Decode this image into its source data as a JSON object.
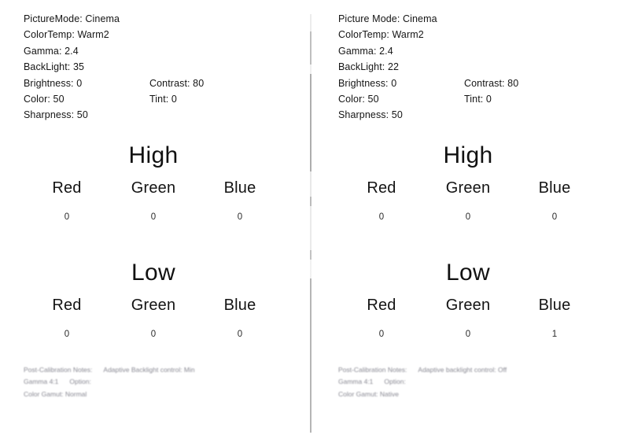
{
  "document": {
    "title": "TV Calibration Settings Comparison",
    "divider_color": "#a8a8a8"
  },
  "panels": [
    {
      "id": "left",
      "settings": {
        "picture_mode_label": "PictureMode: Cinema",
        "color_temp_label": "ColorTemp: Warm2",
        "gamma_label": "Gamma: 2.4",
        "backlight_label": "BackLight: 35",
        "brightness_label": "Brightness: 0",
        "contrast_label": "Contrast: 80",
        "color_label": "Color: 50",
        "tint_label": "Tint: 0",
        "sharpness_label": "Sharpness: 50"
      },
      "high": {
        "title": "High",
        "channels": [
          {
            "label": "Red",
            "value": "0"
          },
          {
            "label": "Green",
            "value": "0"
          },
          {
            "label": "Blue",
            "value": "0"
          }
        ]
      },
      "low": {
        "title": "Low",
        "channels": [
          {
            "label": "Red",
            "value": "0"
          },
          {
            "label": "Green",
            "value": "0"
          },
          {
            "label": "Blue",
            "value": "0"
          }
        ]
      },
      "notes": {
        "line1_a": "Post-Calibration Notes:",
        "line1_b": "Adaptive Backlight control: Min",
        "line2_a": "Gamma 4:1",
        "line2_b": "Option:",
        "line3": "Color Gamut: Normal"
      }
    },
    {
      "id": "right",
      "settings": {
        "picture_mode_label": "Picture Mode: Cinema",
        "color_temp_label": "ColorTemp: Warm2",
        "gamma_label": "Gamma: 2.4",
        "backlight_label": "BackLight: 22",
        "brightness_label": "Brightness: 0",
        "contrast_label": "Contrast: 80",
        "color_label": "Color: 50",
        "tint_label": "Tint: 0",
        "sharpness_label": "Sharpness: 50"
      },
      "high": {
        "title": "High",
        "channels": [
          {
            "label": "Red",
            "value": "0"
          },
          {
            "label": "Green",
            "value": "0"
          },
          {
            "label": "Blue",
            "value": "0"
          }
        ]
      },
      "low": {
        "title": "Low",
        "channels": [
          {
            "label": "Red",
            "value": "0"
          },
          {
            "label": "Green",
            "value": "0"
          },
          {
            "label": "Blue",
            "value": "1"
          }
        ]
      },
      "notes": {
        "line1_a": "Post-Calibration Notes:",
        "line1_b": "Adaptive backlight control: Off",
        "line2_a": "Gamma 4:1",
        "line2_b": "Option:",
        "line3": "Color Gamut: Native"
      }
    }
  ]
}
